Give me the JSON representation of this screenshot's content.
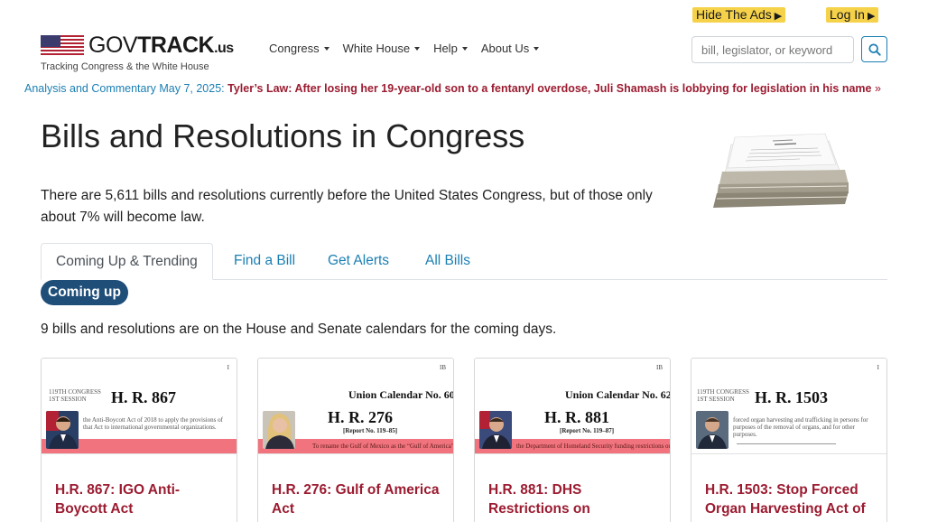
{
  "topbar": {
    "hide_ads": "Hide The Ads",
    "login": "Log In",
    "arrow": "▶"
  },
  "logo": {
    "gov": "GOV",
    "track": "TRACK",
    "us": ".us",
    "tagline": "Tracking Congress & the White House"
  },
  "nav": {
    "items": [
      "Congress",
      "White House",
      "Help",
      "About Us"
    ]
  },
  "search": {
    "placeholder": "bill, legislator, or keyword"
  },
  "banner": {
    "prefix": "Analysis and Commentary May 7, 2025:",
    "headline": "Tyler’s Law: After losing her 19-year-old son to a fentanyl overdose, Juli Shamash is lobbying for legislation in his name",
    "raquo": "»"
  },
  "main": {
    "title": "Bills and Resolutions in Congress",
    "intro": "There are 5,611 bills and resolutions currently before the United States Congress, but of those only about 7% will become law."
  },
  "tabs": [
    "Coming Up & Trending",
    "Find a Bill",
    "Get Alerts",
    "All Bills"
  ],
  "coming_up": {
    "pill": "Coming up",
    "note": "9 bills and resolutions are on the House and Senate calendars for the coming days."
  },
  "cards": [
    {
      "title": "H.R. 867: IGO Anti-Boycott Act",
      "doc_number": "H. R. 867",
      "doc_header": "119TH CONGRESS\n1ST SESSION",
      "doc_calendar": "",
      "doc_report": "",
      "doc_corner": "I",
      "doc_text": "the Anti-Boycott Act of 2018 to apply the provisions of that Act to international governmental organizations."
    },
    {
      "title": "H.R. 276: Gulf of America Act",
      "doc_number": "H. R. 276",
      "doc_header": "",
      "doc_calendar": "Union Calendar No. 60",
      "doc_report": "[Report No. 119–85]",
      "doc_corner": "IB",
      "doc_text": "To rename the Gulf of Mexico as the “Gulf of America”."
    },
    {
      "title": "H.R. 881: DHS Restrictions on",
      "doc_number": "H. R. 881",
      "doc_header": "",
      "doc_calendar": "Union Calendar No. 62",
      "doc_report": "[Report No. 119–87]",
      "doc_corner": "IB",
      "doc_text": "the Department of Homeland Security funding restrictions on institu..."
    },
    {
      "title": "H.R. 1503: Stop Forced Organ Harvesting Act of",
      "doc_number": "H. R. 1503",
      "doc_header": "119TH CONGRESS\n1ST SESSION",
      "doc_calendar": "",
      "doc_report": "",
      "doc_corner": "I",
      "doc_text": "forced organ harvesting and trafficking in persons for purposes of the removal of organs, and for other purposes."
    }
  ],
  "colors": {
    "link_blue": "#1b7fb3",
    "headline_red": "#9b1b30",
    "pill_navy": "#1f4e79",
    "ad_yellow": "#f5d24a"
  }
}
